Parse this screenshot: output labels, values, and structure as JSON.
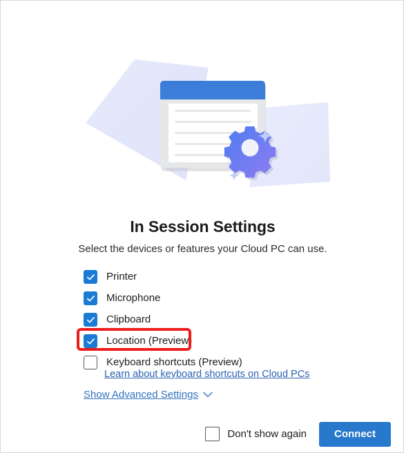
{
  "dialog": {
    "title": "In Session Settings",
    "subtitle": "Select the devices or features your Cloud PC can use.",
    "accent_color": "#2878cc",
    "checkbox_color": "#1a7bd4",
    "link_color": "#3272be",
    "highlight_color": "#ee1b1b"
  },
  "illustration": {
    "name": "settings-document-illustration",
    "titlebar_color": "#3b7dd8",
    "paper_color": "#e4e7fa",
    "gear_gradient_from": "#4e7df0",
    "gear_gradient_to": "#8a7cf0",
    "document_line_count": 5
  },
  "options": [
    {
      "id": "printer",
      "label": "Printer",
      "checked": true,
      "highlighted": false
    },
    {
      "id": "microphone",
      "label": "Microphone",
      "checked": true,
      "highlighted": false
    },
    {
      "id": "clipboard",
      "label": "Clipboard",
      "checked": true,
      "highlighted": false
    },
    {
      "id": "location",
      "label": "Location (Preview)",
      "checked": true,
      "highlighted": true
    },
    {
      "id": "keyboard-shortcuts",
      "label": "Keyboard shortcuts (Preview)",
      "checked": false,
      "highlighted": false
    }
  ],
  "links": {
    "learn_keyboard": "Learn about keyboard shortcuts on Cloud PCs",
    "show_advanced": "Show Advanced Settings",
    "chevron_icon": "chevron-down-icon"
  },
  "footer": {
    "dont_show_again_label": "Don't show again",
    "dont_show_again_checked": false,
    "connect_label": "Connect"
  }
}
